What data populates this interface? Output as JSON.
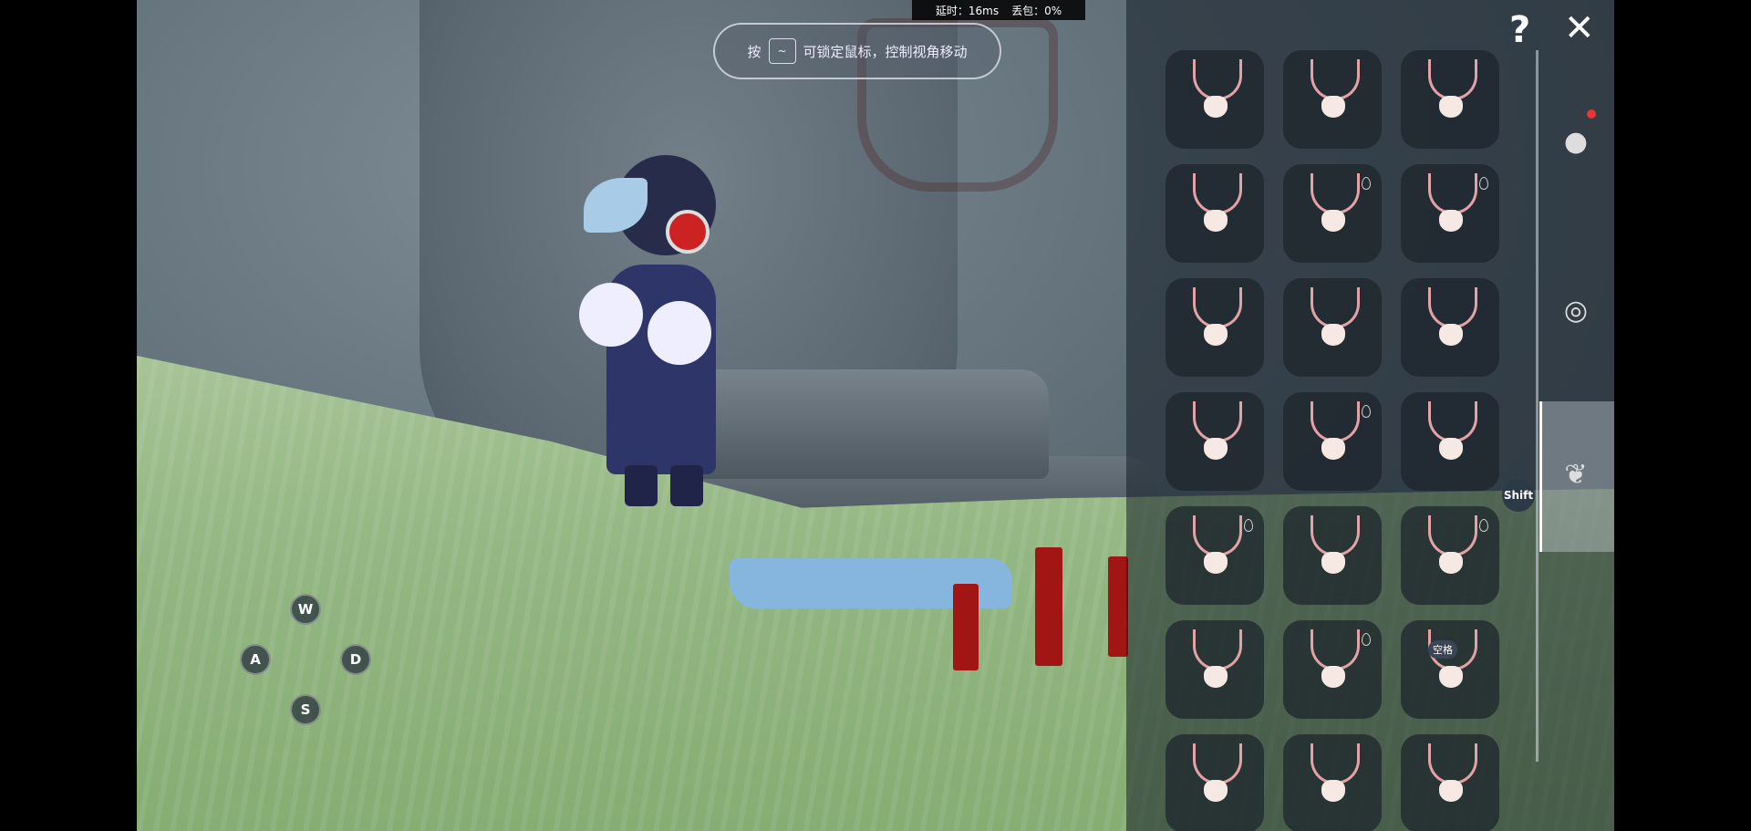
{
  "hud": {
    "latency_label": "延时：16ms",
    "packet_loss_label": "丢包：0%"
  },
  "hint": {
    "prefix": "按",
    "key": "~",
    "text": "可锁定鼠标，控制视角移动"
  },
  "controls": {
    "w": "W",
    "a": "A",
    "s": "S",
    "d": "D"
  },
  "panel": {
    "help_label": "?",
    "close_label": "✕",
    "shift_label": "Shift",
    "space_label": "空格",
    "accent": "#e3a2a6",
    "tiles": [
      {
        "variant": "bow-small",
        "drop": false
      },
      {
        "variant": "tie",
        "drop": false
      },
      {
        "variant": "bib",
        "drop": false
      },
      {
        "variant": "crab",
        "drop": false
      },
      {
        "variant": "scarf",
        "drop": true
      },
      {
        "variant": "cape",
        "drop": true
      },
      {
        "variant": "collar-spiky",
        "drop": false
      },
      {
        "variant": "bell",
        "drop": false
      },
      {
        "variant": "bow-big",
        "drop": false
      },
      {
        "variant": "scarf-striped",
        "drop": false
      },
      {
        "variant": "collar",
        "drop": true
      },
      {
        "variant": "bow-ribbon",
        "drop": false
      },
      {
        "variant": "small-bow",
        "drop": true
      },
      {
        "variant": "shell",
        "drop": false
      },
      {
        "variant": "flower",
        "drop": true
      },
      {
        "variant": "bow-black",
        "drop": false
      },
      {
        "variant": "knit-scarf",
        "drop": true
      },
      {
        "variant": "long-strap",
        "drop": false,
        "space": true
      },
      {
        "variant": "pearl",
        "drop": false
      },
      {
        "variant": "pink-bow",
        "drop": false
      },
      {
        "variant": "white-bow",
        "drop": false
      }
    ]
  },
  "side_tabs": [
    {
      "icon": "mask-icon"
    },
    {
      "icon": "glasses-icon"
    },
    {
      "icon": "necklace-icon",
      "selected": true
    }
  ]
}
